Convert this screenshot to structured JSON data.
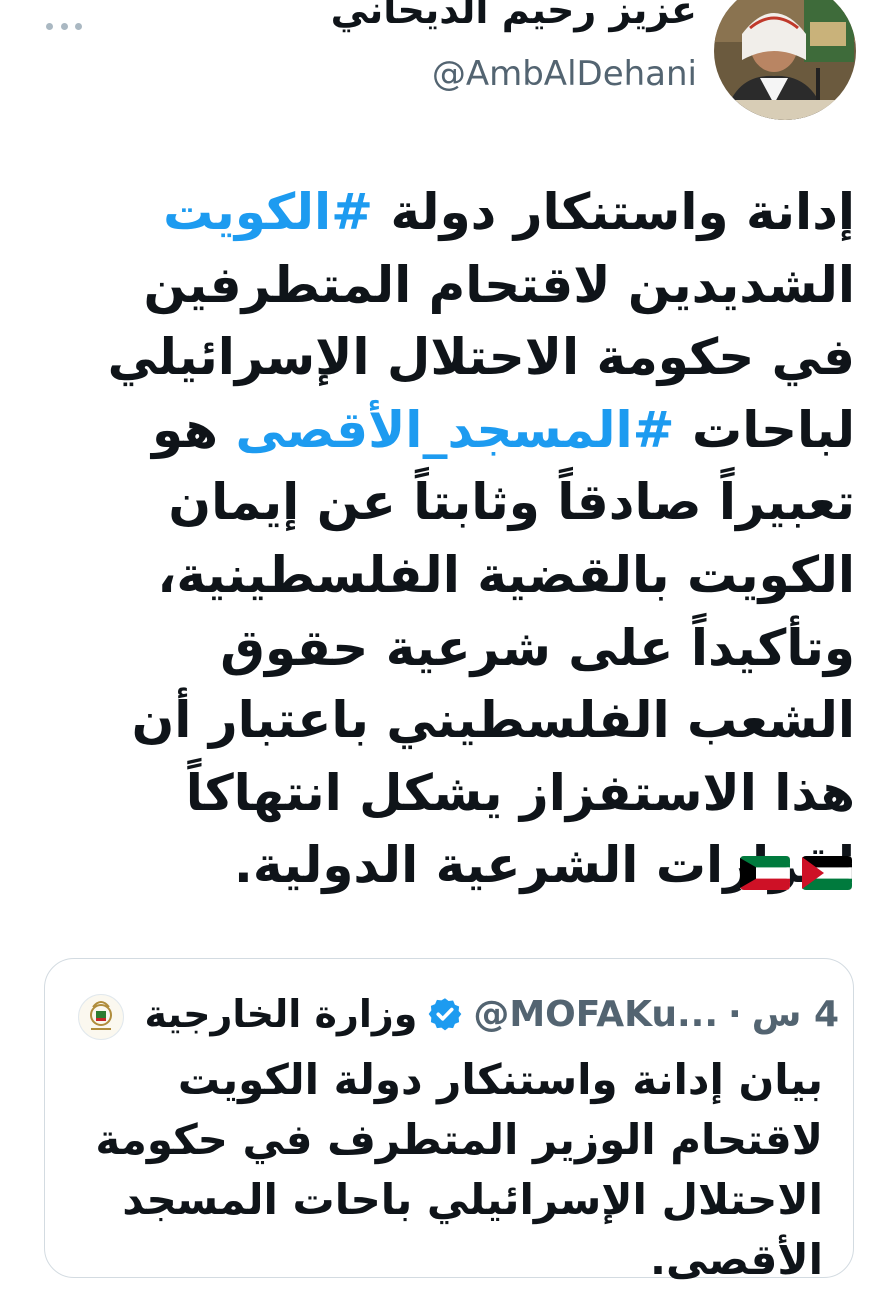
{
  "author": {
    "name": "عزيز رحيم الديحاني",
    "handle": "@AmbAlDehani",
    "avatar_icon": "user-photo-icon"
  },
  "tweet": {
    "text_start": "إدانة واستنكار دولة ",
    "hashtag_1": "#الكويت",
    "text_middle": " الشديدين لاقتحام المتطرفين في حكومة الاحتلال الإسرائيلي لباحات ",
    "hashtag_2": "#المسجد_الأقصى",
    "text_end": " هو تعبيراً صادقاً وثابتاً عن إيمان الكويت بالقضية الفلسطينية، وتأكيداً على شرعية حقوق الشعب الفلسطيني باعتبار أن هذا الاستفزاز يشكل انتهاكاً لقرارات الشرعية الدولية.",
    "flags": [
      "palestine-flag-icon",
      "kuwait-flag-icon"
    ]
  },
  "quoted_tweet": {
    "name": "وزارة الخارجية",
    "handle": "@MOFAKu...",
    "separator": "·",
    "time": "4 س",
    "text": "بيان إدانة واستنكار دولة الكويت لاقتحام الوزير المتطرف في حكومة الاحتلال الإسرائيلي باحات المسجد الأقصى."
  },
  "colors": {
    "hashtag": "#1d9bf0",
    "text": "#0f1419",
    "secondary": "#536471",
    "verified": "#1d9bf0",
    "border": "#d3dbe1"
  }
}
